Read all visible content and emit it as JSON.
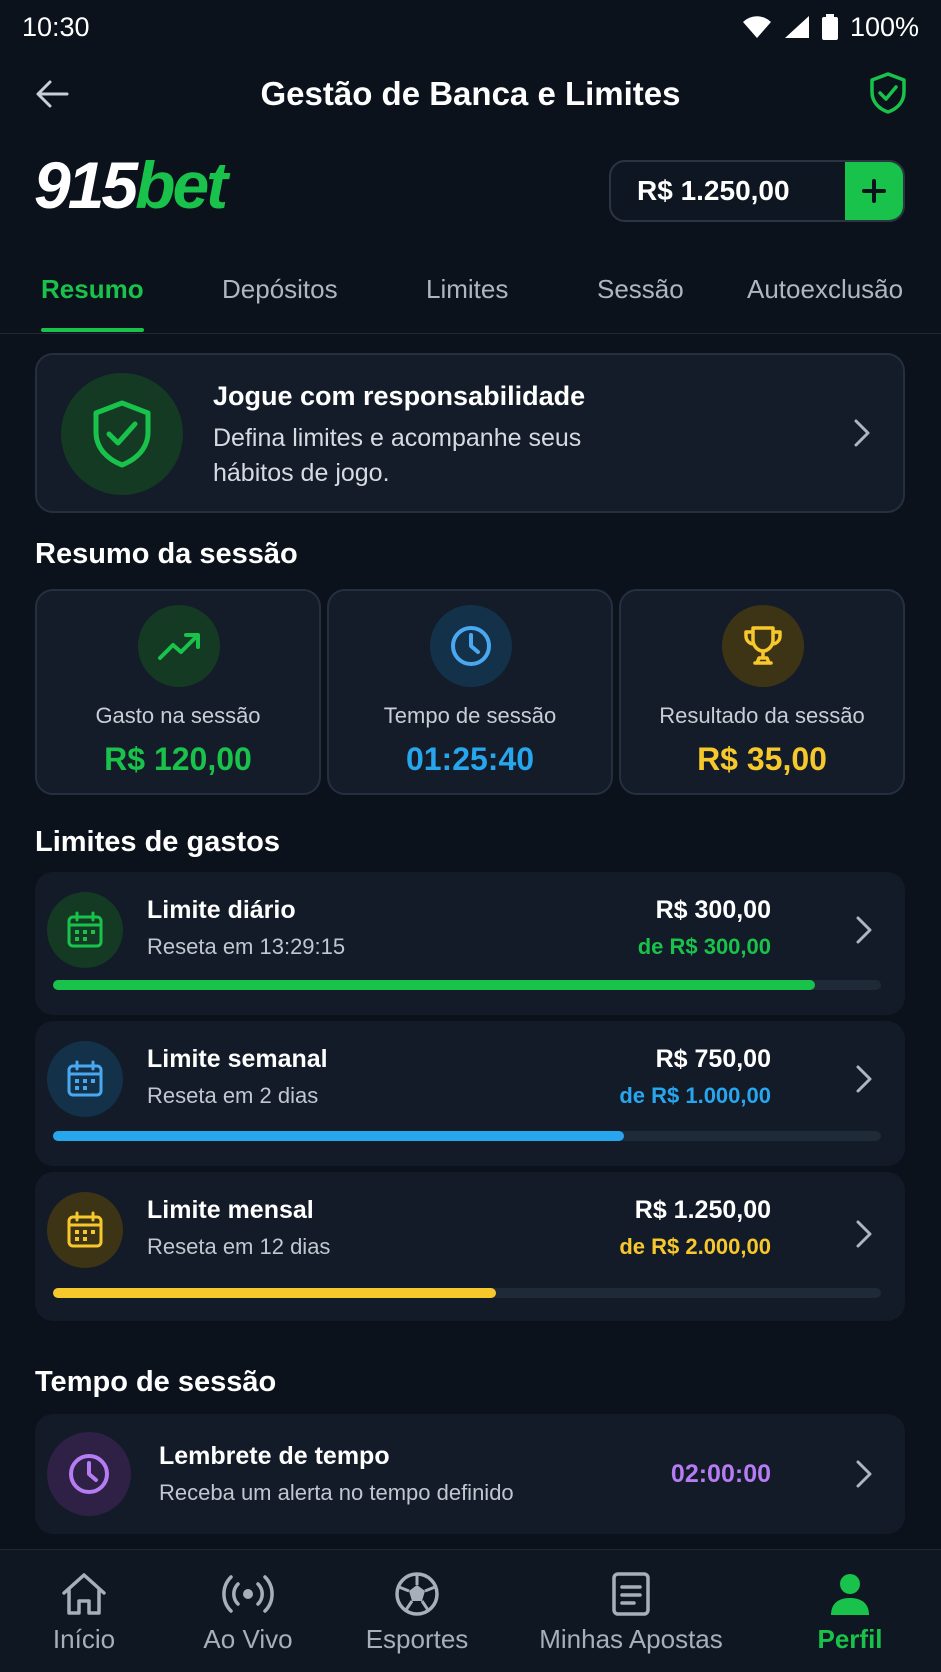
{
  "status_bar": {
    "time": "10:30",
    "battery": "100%"
  },
  "header": {
    "title": "Gestão de Banca e Limites"
  },
  "brand": {
    "logo_number": "915",
    "logo_word": "bet",
    "balance": "R$ 1.250,00"
  },
  "tabs": [
    {
      "label": "Resumo",
      "active": true
    },
    {
      "label": "Depósitos",
      "active": false
    },
    {
      "label": "Limites",
      "active": false
    },
    {
      "label": "Sessão",
      "active": false
    },
    {
      "label": "Autoexclusão",
      "active": false
    }
  ],
  "responsible": {
    "title": "Jogue com responsabilidade",
    "description": "Defina limites e acompanhe seus hábitos de jogo.",
    "icon": "shield-check-icon"
  },
  "session_summary": {
    "title": "Resumo da sessão",
    "stats": [
      {
        "label": "Gasto na sessão",
        "value": "R$ 120,00",
        "color": "#19c24a",
        "icon": "trending-up-icon"
      },
      {
        "label": "Tempo de sessão",
        "value": "01:25:40",
        "color": "#27a6ee",
        "icon": "clock-icon"
      },
      {
        "label": "Resultado da sessão",
        "value": "R$ 35,00",
        "color": "#f7c82b",
        "icon": "trophy-icon"
      }
    ]
  },
  "spending_limits": {
    "title": "Limites de gastos",
    "items": [
      {
        "title": "Limite diário",
        "reset": "Reseta em 13:29:15",
        "amount": "R$ 300,00",
        "of": "de R$ 300,00",
        "progress": 0.92,
        "color": "#19c24a",
        "icon": "calendar-icon"
      },
      {
        "title": "Limite semanal",
        "reset": "Reseta em 2 dias",
        "amount": "R$ 750,00",
        "of": "de R$ 1.000,00",
        "progress": 0.69,
        "color": "#27a6ee",
        "icon": "calendar-icon"
      },
      {
        "title": "Limite mensal",
        "reset": "Reseta em 12 dias",
        "amount": "R$ 1.250,00",
        "of": "de R$ 2.000,00",
        "progress": 0.535,
        "color": "#f7c82b",
        "icon": "calendar-icon"
      }
    ]
  },
  "session_time": {
    "title": "Tempo de sessão",
    "reminder": {
      "title": "Lembrete de tempo",
      "description": "Receba um alerta no tempo definido",
      "value": "02:00:00",
      "color": "#b57cf4",
      "icon": "clock-icon"
    }
  },
  "bottom_nav": [
    {
      "label": "Início",
      "icon": "home-icon",
      "active": false
    },
    {
      "label": "Ao Vivo",
      "icon": "live-broadcast-icon",
      "active": false
    },
    {
      "label": "Esportes",
      "icon": "soccer-ball-icon",
      "active": false
    },
    {
      "label": "Minhas Apostas",
      "icon": "ticket-icon",
      "active": false
    },
    {
      "label": "Perfil",
      "icon": "user-icon",
      "active": true
    }
  ],
  "colors": {
    "accent": "#19c24a",
    "background": "#0b121c",
    "card": "#131c28"
  }
}
